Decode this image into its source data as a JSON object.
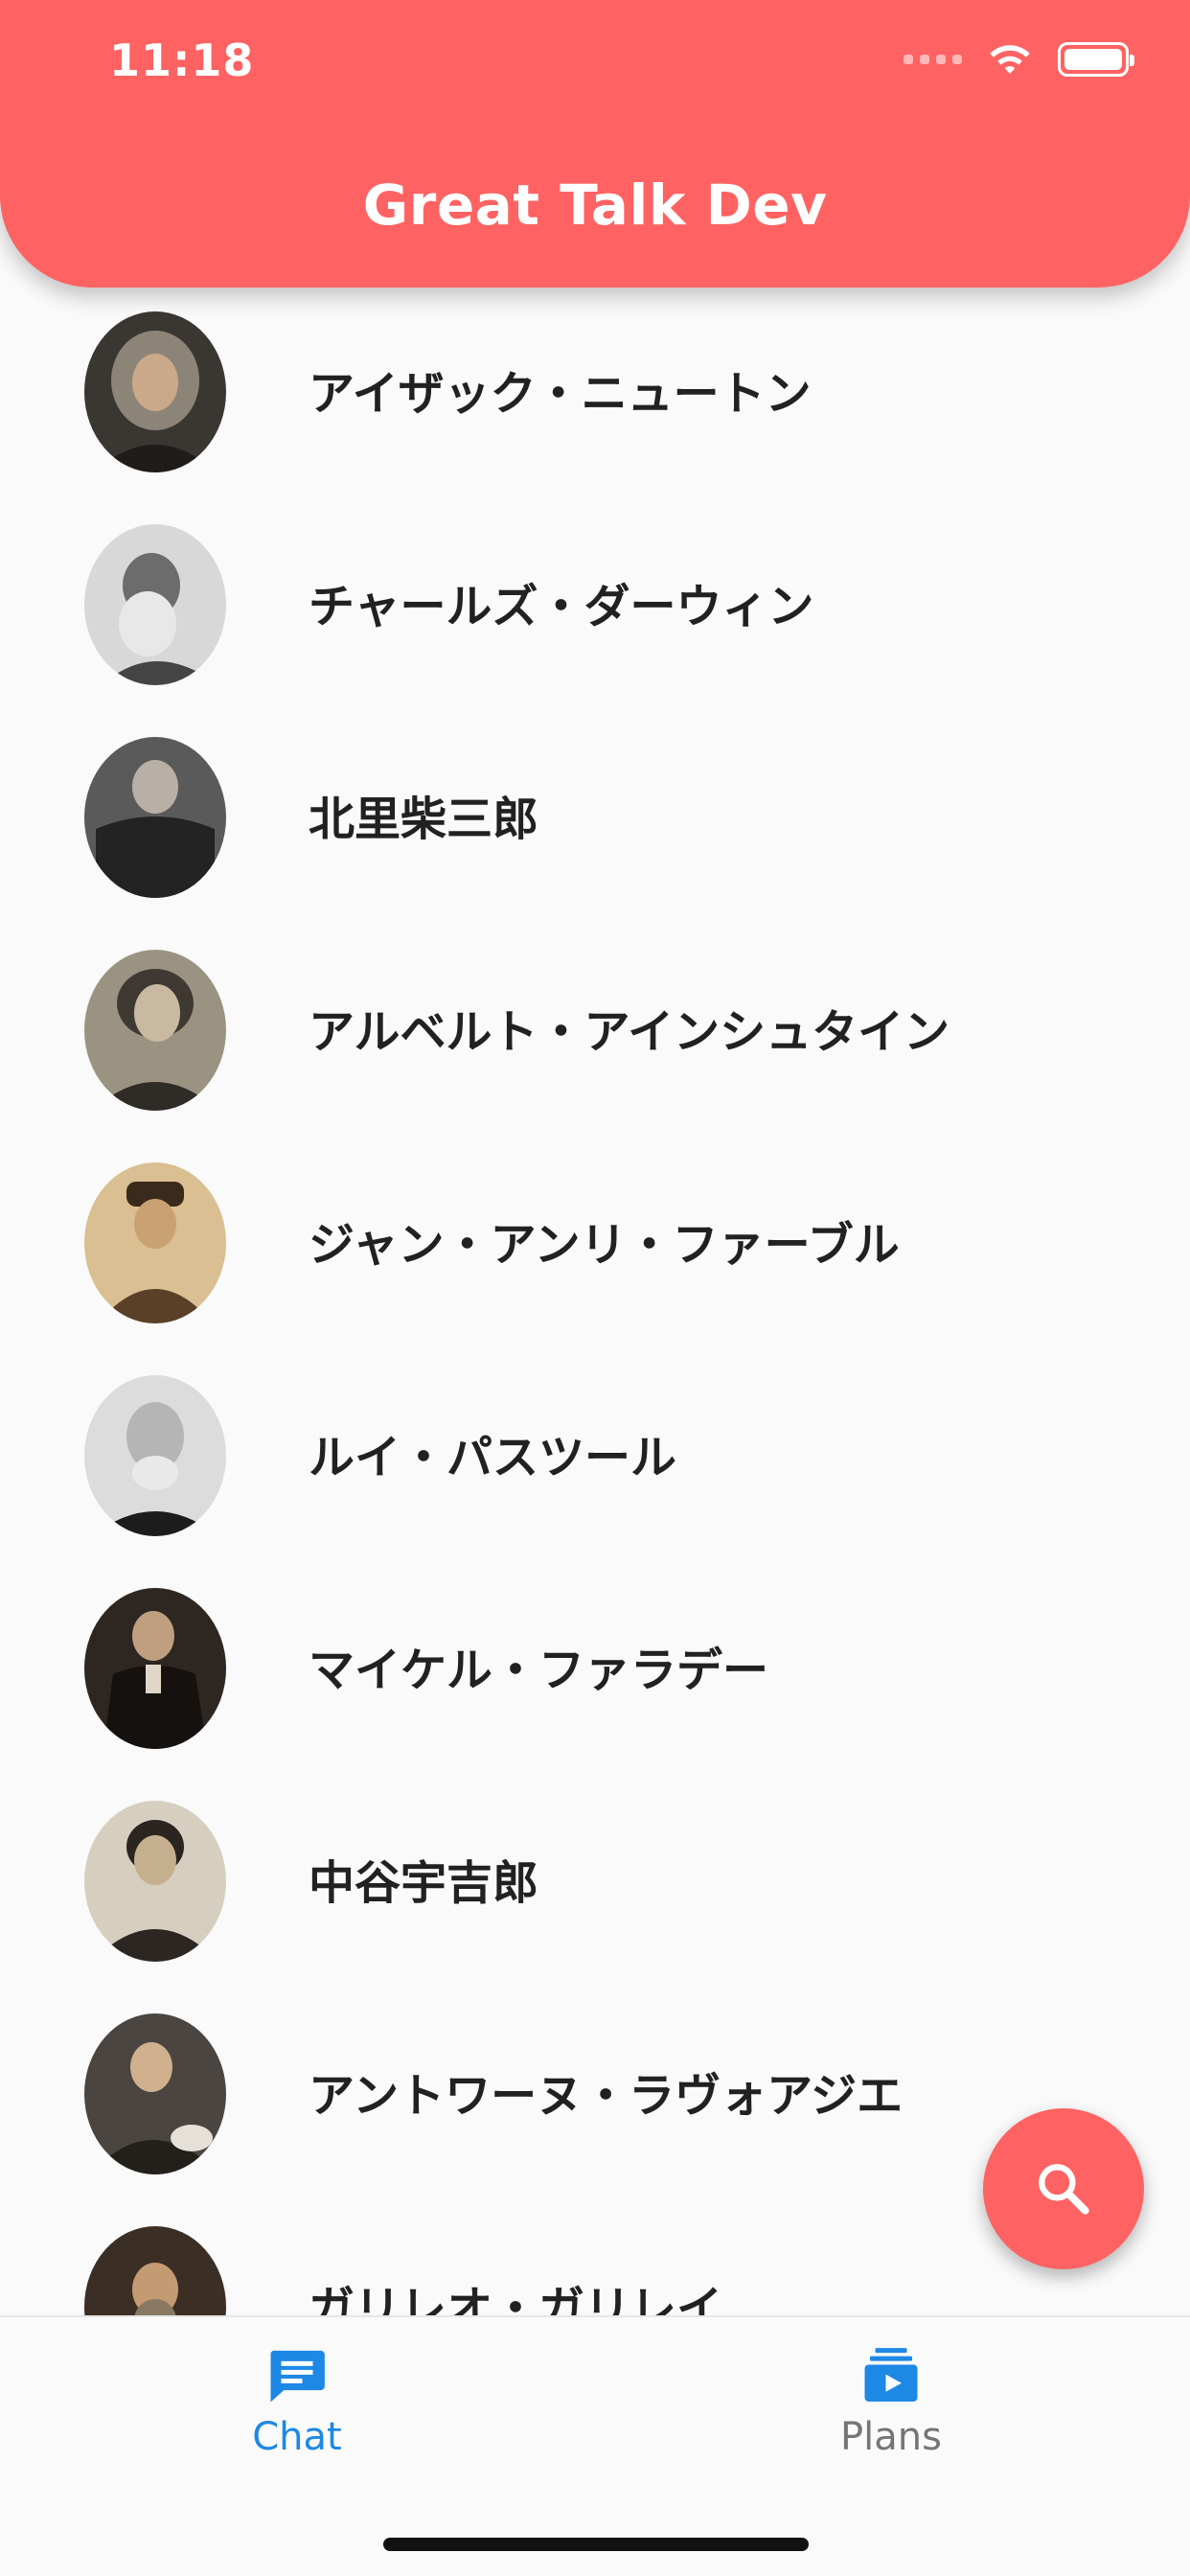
{
  "status_bar": {
    "time": "11:18"
  },
  "app_bar": {
    "title": "Great Talk Dev"
  },
  "people": [
    {
      "name": "アイザック・ニュートン",
      "avatar_bg": "#3a3632"
    },
    {
      "name": "チャールズ・ダーウィン",
      "avatar_bg": "#9a9a9a"
    },
    {
      "name": "北里柴三郎",
      "avatar_bg": "#3d3d3d"
    },
    {
      "name": "アルベルト・アインシュタイン",
      "avatar_bg": "#6c6658"
    },
    {
      "name": "ジャン・アンリ・ファーブル",
      "avatar_bg": "#b89465"
    },
    {
      "name": "ルイ・パスツール",
      "avatar_bg": "#8a8a8a"
    },
    {
      "name": "マイケル・ファラデー",
      "avatar_bg": "#2e2620"
    },
    {
      "name": "中谷宇吉郎",
      "avatar_bg": "#7d7668"
    },
    {
      "name": "アントワーヌ・ラヴォアジエ",
      "avatar_bg": "#4a4540"
    },
    {
      "name": "ガリレオ・ガリレイ",
      "avatar_bg": "#3b2e24"
    }
  ],
  "fab": {
    "icon": "search-icon"
  },
  "bottom_nav": {
    "items": [
      {
        "label": "Chat",
        "icon": "chat-icon",
        "active": true
      },
      {
        "label": "Plans",
        "icon": "subscriptions-icon",
        "active": false
      }
    ],
    "active_color": "#1e88e5",
    "inactive_color": "#757575"
  },
  "colors": {
    "primary": "#ff6262",
    "background": "#fafafa"
  }
}
